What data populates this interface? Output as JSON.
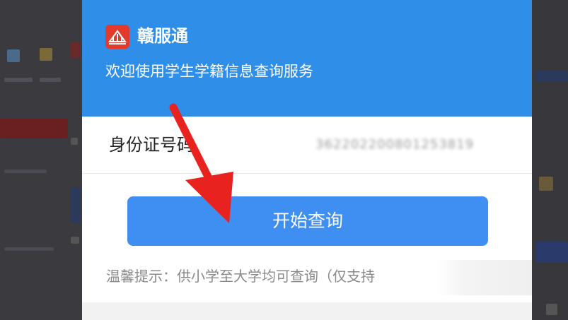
{
  "dialog": {
    "app_name": "赣服通",
    "welcome_text": "欢迎使用学生学籍信息查询服务",
    "id_field": {
      "label": "身份证号码",
      "value": "362202200801253819"
    },
    "query_button_label": "开始查询",
    "tip_text": "温馨提示：供小学至大学均可查询（仅支持"
  },
  "annotation": {
    "arrow_color": "#e8231f"
  },
  "colors": {
    "header_blue": "#2f8ee8",
    "button_blue": "#3f8ef2",
    "logo_red": "#e23b2e"
  },
  "icons": {
    "logo": "app-logo-icon",
    "annotation": "red-arrow-annotation"
  }
}
